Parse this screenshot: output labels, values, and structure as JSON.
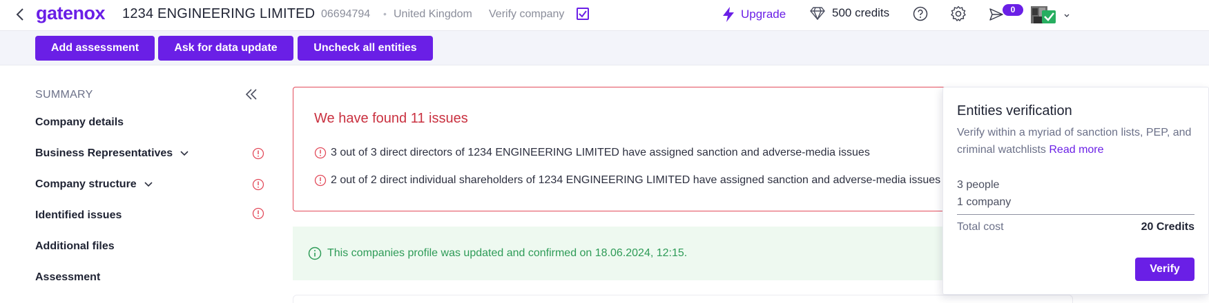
{
  "header": {
    "logo": "gatenox",
    "company_name": "1234 ENGINEERING LIMITED",
    "company_id": "06694794",
    "separator": "•",
    "country": "United Kingdom",
    "verify_company_label": "Verify company",
    "upgrade_label": "Upgrade",
    "credits_label": "500 credits",
    "notifications_count": "0"
  },
  "actions": {
    "add_assessment": "Add assessment",
    "ask_update": "Ask for data update",
    "uncheck_all": "Uncheck all entities"
  },
  "sidebar": {
    "title": "SUMMARY",
    "items": [
      {
        "label": "Company details"
      },
      {
        "label": "Business Representatives"
      },
      {
        "label": "Company structure"
      },
      {
        "label": "Identified issues"
      },
      {
        "label": "Additional files"
      },
      {
        "label": "Assessment"
      }
    ]
  },
  "issues": {
    "title": "We have found 11 issues",
    "lines": [
      "3 out of 3 direct directors of 1234 ENGINEERING LIMITED have assigned sanction and adverse-media issues",
      "2 out of 2 direct individual shareholders of 1234 ENGINEERING LIMITED have assigned sanction and adverse-media issues"
    ]
  },
  "info_banner": {
    "text": "This companies profile was updated and confirmed on 18.06.2024, 12:15."
  },
  "popover": {
    "title": "Entities verification",
    "description": "Verify within a myriad of sanction lists, PEP, and criminal watchlists",
    "read_more": "Read more",
    "people": "3 people",
    "companies": "1 company",
    "total_label": "Total cost",
    "total_value": "20 Credits",
    "verify_label": "Verify"
  },
  "colors": {
    "brand": "#6a1fe6",
    "danger": "#e24a5a",
    "success": "#2e9b57"
  }
}
